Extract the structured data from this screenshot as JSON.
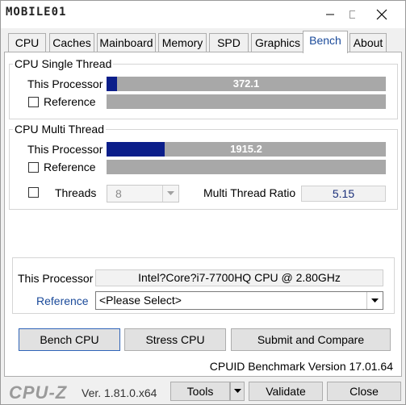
{
  "brand": {
    "logo_text": "MOBILE01",
    "app_logo": "CPU-Z",
    "version": "Ver. 1.81.0.x64"
  },
  "titlebar": {
    "icons": [
      "minimize-icon",
      "maximize-icon",
      "close-icon"
    ]
  },
  "tabs": [
    {
      "label": "CPU"
    },
    {
      "label": "Caches"
    },
    {
      "label": "Mainboard"
    },
    {
      "label": "Memory"
    },
    {
      "label": "SPD"
    },
    {
      "label": "Graphics"
    },
    {
      "label": "Bench",
      "active": true
    },
    {
      "label": "About"
    }
  ],
  "single": {
    "title": "CPU Single Thread",
    "this_label": "This Processor",
    "this_value": "372.1",
    "this_fraction": 0.039,
    "ref_label": "Reference"
  },
  "multi": {
    "title": "CPU Multi Thread",
    "this_label": "This Processor",
    "this_value": "1915.2",
    "this_fraction": 0.207,
    "ref_label": "Reference",
    "threads_label": "Threads",
    "threads_value": "8",
    "ratio_label": "Multi Thread Ratio",
    "ratio_value": "5.15"
  },
  "processor": {
    "this_label": "This Processor",
    "this_value": "Intel?Core?i7-7700HQ CPU @ 2.80GHz",
    "ref_label": "Reference",
    "ref_select": "<Please Select>"
  },
  "buttons": {
    "bench": "Bench CPU",
    "stress": "Stress CPU",
    "submit": "Submit and Compare"
  },
  "bench_version": "CPUID Benchmark Version 17.01.64",
  "footer": {
    "tools": "Tools",
    "validate": "Validate",
    "close": "Close"
  },
  "colors": {
    "bar_fill": "#0b1e8a",
    "bar_bg": "#a8a8a8",
    "active_tab_text": "#1a4a9a",
    "reference_link": "#1a4a9a"
  }
}
